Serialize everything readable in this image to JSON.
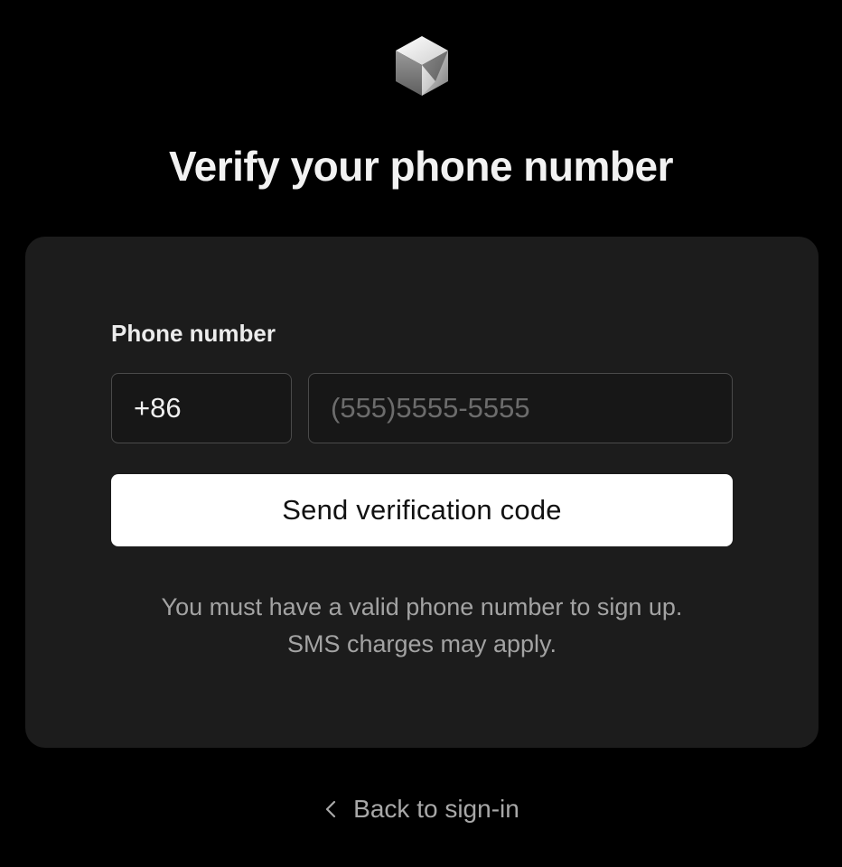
{
  "page": {
    "title": "Verify your phone number"
  },
  "logo": {
    "icon": "cube-logo-icon"
  },
  "form": {
    "phone_label": "Phone number",
    "country_code": "+86",
    "phone_value": "",
    "phone_placeholder": "(555)5555-5555",
    "send_label": "Send verification code",
    "note_line1": "You must have a valid phone number to sign up.",
    "note_line2": "SMS charges may apply."
  },
  "footer": {
    "back_label": "Back to sign-in",
    "back_icon": "chevron-left-icon"
  },
  "colors": {
    "background": "#000000",
    "card": "#1c1c1c",
    "button": "#ffffff",
    "muted_text": "#a3a3a3"
  }
}
